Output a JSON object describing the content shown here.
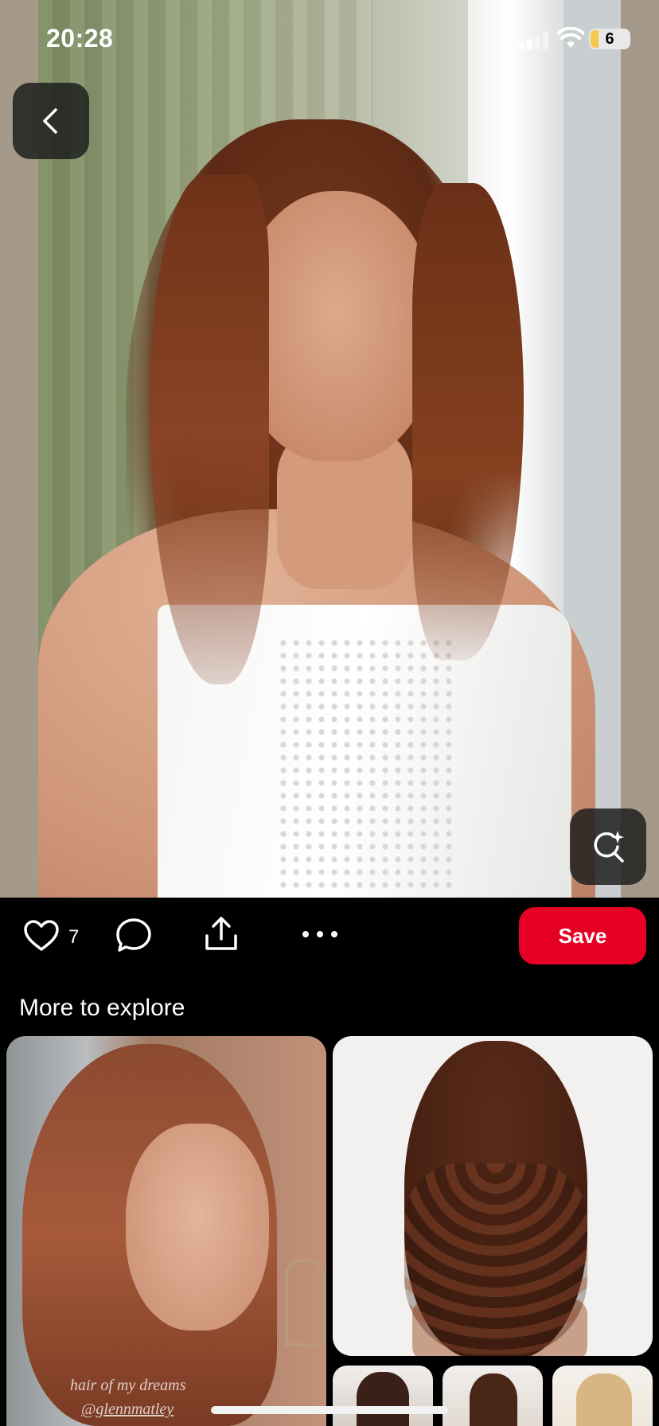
{
  "status_bar": {
    "time": "20:28",
    "battery_level": "6"
  },
  "pin": {
    "like_count": "7",
    "save_label": "Save"
  },
  "explore": {
    "title": "More to explore",
    "cards": [
      {
        "watermark_line1": "hair of my dreams",
        "watermark_line2": "@glennmatley"
      }
    ]
  },
  "colors": {
    "save_button": "#e60023",
    "background": "#000000",
    "text": "#ffffff"
  },
  "icons": {
    "back": "chevron-left-icon",
    "visual_search": "lens-sparkle-icon",
    "like": "heart-icon",
    "comment": "comment-bubble-icon",
    "share": "share-upload-icon",
    "more": "ellipsis-icon"
  }
}
